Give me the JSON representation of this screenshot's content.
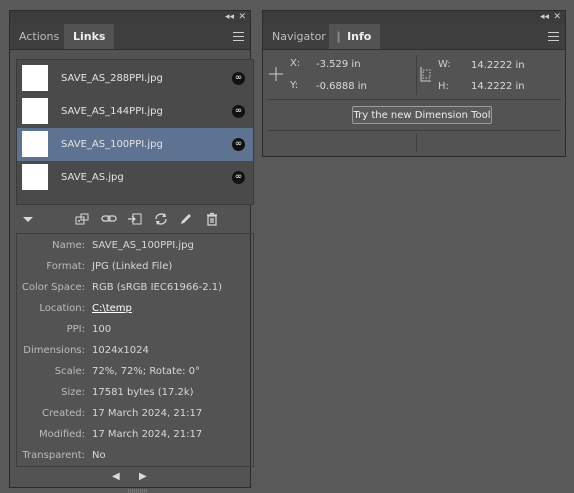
{
  "links_panel": {
    "tabs": [
      {
        "label": "Actions",
        "active": false
      },
      {
        "label": "Links",
        "active": true
      }
    ],
    "items": [
      {
        "name": "SAVE_AS_288PPI.jpg",
        "selected": false
      },
      {
        "name": "SAVE_AS_144PPI.jpg",
        "selected": false
      },
      {
        "name": "SAVE_AS_100PPI.jpg",
        "selected": true
      },
      {
        "name": "SAVE_AS.jpg",
        "selected": false
      }
    ],
    "toolbar_icons": [
      "disclosure-triangle-icon",
      "relink-from-cc-icon",
      "relink-icon",
      "go-to-link-icon",
      "update-link-icon",
      "edit-original-icon",
      "delete-icon"
    ],
    "info": {
      "name": {
        "label": "Name:",
        "value": "SAVE_AS_100PPI.jpg"
      },
      "format": {
        "label": "Format:",
        "value": "JPG (Linked File)"
      },
      "color_space": {
        "label": "Color Space:",
        "value": "RGB (sRGB IEC61966-2.1)"
      },
      "location": {
        "label": "Location:",
        "value": "C:\\temp"
      },
      "ppi": {
        "label": "PPI:",
        "value": "100"
      },
      "dimensions": {
        "label": "Dimensions:",
        "value": "1024x1024"
      },
      "scale": {
        "label": "Scale:",
        "value": "72%, 72%; Rotate: 0°"
      },
      "size": {
        "label": "Size:",
        "value": "17581 bytes (17.2k)"
      },
      "created": {
        "label": "Created:",
        "value": "17 March 2024, 21:17"
      },
      "modified": {
        "label": "Modified:",
        "value": "17 March 2024, 21:17"
      },
      "transparent": {
        "label": "Transparent:",
        "value": "No"
      }
    },
    "pager": {
      "prev": "◀",
      "next": "▶"
    }
  },
  "info_panel": {
    "tabs": [
      {
        "label": "Navigator",
        "active": false
      },
      {
        "label": "Info",
        "active": true
      }
    ],
    "x_label": "X:",
    "x_value": "-3.529 in",
    "y_label": "Y:",
    "y_value": "-0.6888 in",
    "w_label": "W:",
    "w_value": "14.2222 in",
    "h_label": "H:",
    "h_value": "14.2222 in",
    "button_label": "Try the new Dimension Tool"
  },
  "window_controls": {
    "collapse": "◂◂",
    "close": "✕"
  }
}
